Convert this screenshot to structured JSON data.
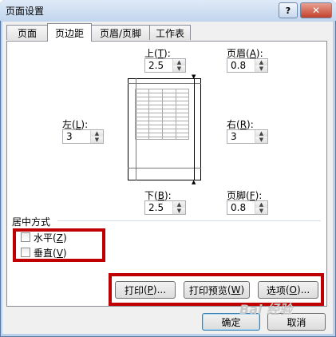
{
  "window": {
    "title": "页面设置",
    "help_label": "?",
    "close_label": "✕"
  },
  "tabs": [
    {
      "label": "页面",
      "active": false
    },
    {
      "label": "页边距",
      "active": true
    },
    {
      "label": "页眉/页脚",
      "active": false
    },
    {
      "label": "工作表",
      "active": false
    }
  ],
  "margins": {
    "top": {
      "label": "上",
      "key": "T",
      "value": "2.5"
    },
    "header": {
      "label": "页眉",
      "key": "A",
      "value": "0.8"
    },
    "left": {
      "label": "左",
      "key": "L",
      "value": "3"
    },
    "right": {
      "label": "右",
      "key": "R",
      "value": "3"
    },
    "bottom": {
      "label": "下",
      "key": "B",
      "value": "2.5"
    },
    "footer": {
      "label": "页脚",
      "key": "F",
      "value": "0.8"
    }
  },
  "centering": {
    "title": "居中方式",
    "horizontal": {
      "label": "水平",
      "key": "Z",
      "checked": false
    },
    "vertical": {
      "label": "垂直",
      "key": "V",
      "checked": false
    }
  },
  "actions": {
    "print": {
      "label": "打印",
      "key": "P",
      "suffix": "..."
    },
    "preview": {
      "label": "打印预览",
      "key": "W"
    },
    "options": {
      "label": "选项",
      "key": "O",
      "suffix": "..."
    }
  },
  "footer_buttons": {
    "ok": "确定",
    "cancel": "取消"
  },
  "watermark": "Bai 经验",
  "colors": {
    "highlight_box": "#c00000",
    "title_bar": "#c2d6ee"
  }
}
